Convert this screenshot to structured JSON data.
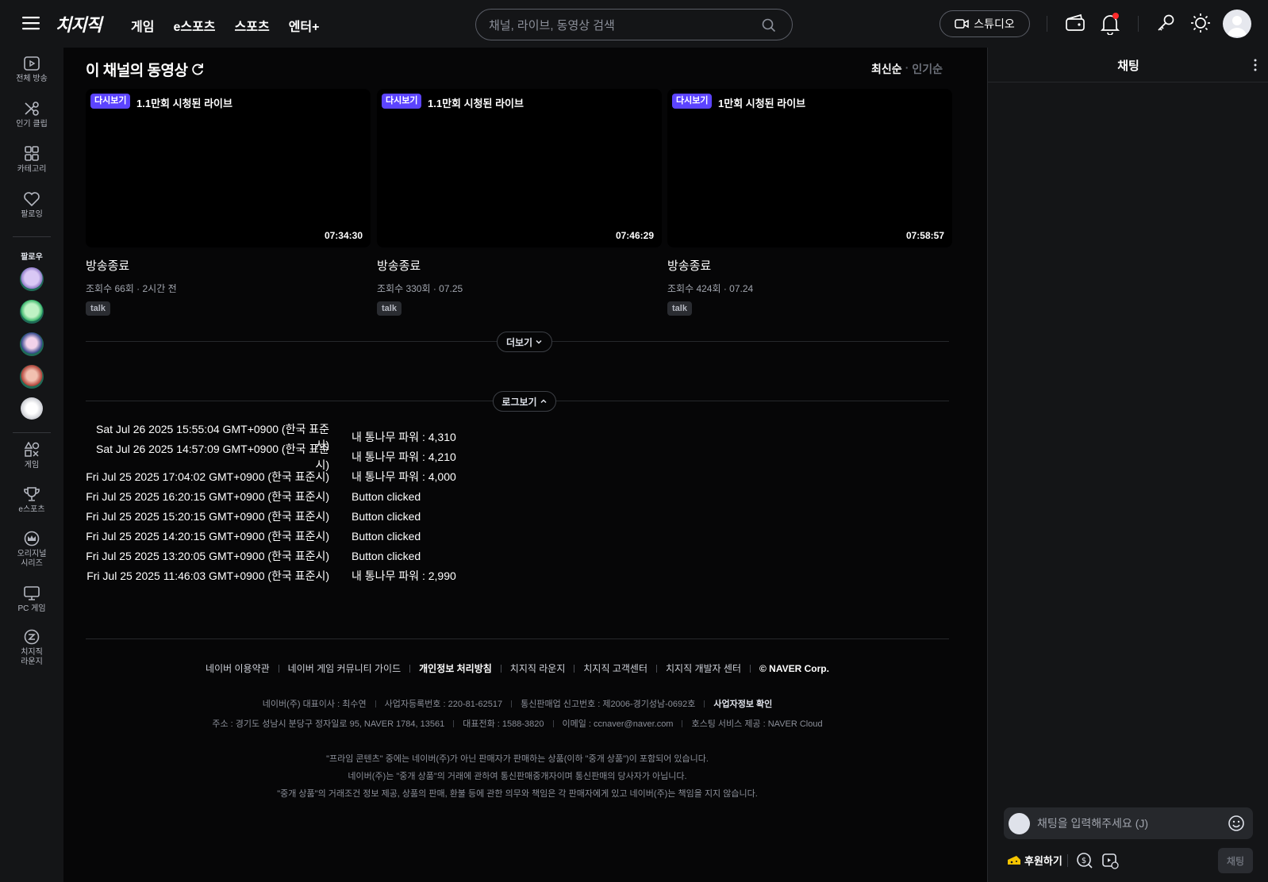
{
  "header": {
    "logo": "치지직",
    "nav": [
      "게임",
      "e스포츠",
      "스포츠",
      "엔터+"
    ],
    "search_placeholder": "채널, 라이브, 동영상 검색",
    "studio_label": "스튜디오"
  },
  "sidebar": {
    "items": [
      {
        "label": "전체 방송",
        "icon": "broadcast-icon"
      },
      {
        "label": "인기 클립",
        "icon": "scissors-icon"
      },
      {
        "label": "카테고리",
        "icon": "category-grid-icon"
      },
      {
        "label": "팔로잉",
        "icon": "heart-icon"
      }
    ],
    "follow_label": "팔로우",
    "bottom_items": [
      {
        "label": "게임",
        "icon": "game-icon"
      },
      {
        "label": "e스포츠",
        "icon": "trophy-icon"
      },
      {
        "label": "오리지널\n시리즈",
        "label1": "오리지널",
        "label2": "시리즈",
        "icon": "crown-icon"
      },
      {
        "label": "PC 게임",
        "icon": "monitor-icon"
      },
      {
        "label": "치지직\n라운지",
        "label1": "치지직",
        "label2": "라운지",
        "icon": "lounge-icon"
      }
    ]
  },
  "main": {
    "section_title": "이 채널의 동영상",
    "sort_active": "최신순",
    "sort_inactive": "인기순",
    "videos": [
      {
        "badge": "다시보기",
        "live_views": "1.1만회 시청된 라이브",
        "duration": "07:34:30",
        "title": "방송종료",
        "meta": "조회수 66회 · 2시간 전",
        "tag": "talk"
      },
      {
        "badge": "다시보기",
        "live_views": "1.1만회 시청된 라이브",
        "duration": "07:46:29",
        "title": "방송종료",
        "meta": "조회수 330회 · 07.25",
        "tag": "talk"
      },
      {
        "badge": "다시보기",
        "live_views": "1만회 시청된 라이브",
        "duration": "07:58:57",
        "title": "방송종료",
        "meta": "조회수 424회 · 07.24",
        "tag": "talk"
      }
    ],
    "more_label": "더보기",
    "log_label": "로그보기",
    "logs": [
      {
        "ts": "Sat Jul 26 2025 15:55:04 GMT+0900 (한국 표준시)",
        "msg": "내 통나무 파워 : 4,310"
      },
      {
        "ts": "Sat Jul 26 2025 14:57:09 GMT+0900 (한국 표준시)",
        "msg": "내 통나무 파워 : 4,210"
      },
      {
        "ts": "Fri Jul 25 2025 17:04:02 GMT+0900 (한국 표준시)",
        "msg": "내 통나무 파워 : 4,000"
      },
      {
        "ts": "Fri Jul 25 2025 16:20:15 GMT+0900 (한국 표준시)",
        "msg": "Button clicked"
      },
      {
        "ts": "Fri Jul 25 2025 15:20:15 GMT+0900 (한국 표준시)",
        "msg": "Button clicked"
      },
      {
        "ts": "Fri Jul 25 2025 14:20:15 GMT+0900 (한국 표준시)",
        "msg": "Button clicked"
      },
      {
        "ts": "Fri Jul 25 2025 13:20:05 GMT+0900 (한국 표준시)",
        "msg": "Button clicked"
      },
      {
        "ts": "Fri Jul 25 2025 11:46:03 GMT+0900 (한국 표준시)",
        "msg": "내 통나무 파워 : 2,990"
      }
    ]
  },
  "footer": {
    "links": [
      "네이버 이용약관",
      "네이버 게임 커뮤니티 가이드",
      "개인정보 처리방침",
      "치지직 라운지",
      "치지직 고객센터",
      "치지직 개발자 센터",
      "© NAVER Corp."
    ],
    "info_line1": [
      "네이버(주) 대표이사 : 최수연",
      "사업자등록번호 : 220-81-62517",
      "통신판매업 신고번호 : 제2006-경기성남-0692호",
      "사업자정보 확인"
    ],
    "info_line2": [
      "주소 : 경기도 성남시 분당구 정자일로 95, NAVER 1784, 13561",
      "대표전화 : 1588-3820",
      "이메일 : ccnaver@naver.com",
      "호스팅 서비스 제공 : NAVER Cloud"
    ],
    "notes": [
      "\"프라임 콘텐츠\" 중에는 네이버(주)가 아닌 판매자가 판매하는 상품(이하 \"중개 상품\")이 포함되어 있습니다.",
      "네이버(주)는 \"중개 상품\"의 거래에 관하여 통신판매중개자이며 통신판매의 당사자가 아닙니다.",
      "\"중개 상품\"의 거래조건 정보 제공, 상품의 판매, 환불 등에 관한 의무와 책임은 각 판매자에게 있고 네이버(주)는 책임을 지지 않습니다."
    ]
  },
  "chat": {
    "title": "채팅",
    "input_placeholder": "채팅을 입력해주세요 (J)",
    "donate_label": "후원하기",
    "send_label": "채팅"
  },
  "colors": {
    "accent_badge": "#5c44ff",
    "notification_dot": "#ff2b2b",
    "donate_yellow": "#f5c400"
  }
}
